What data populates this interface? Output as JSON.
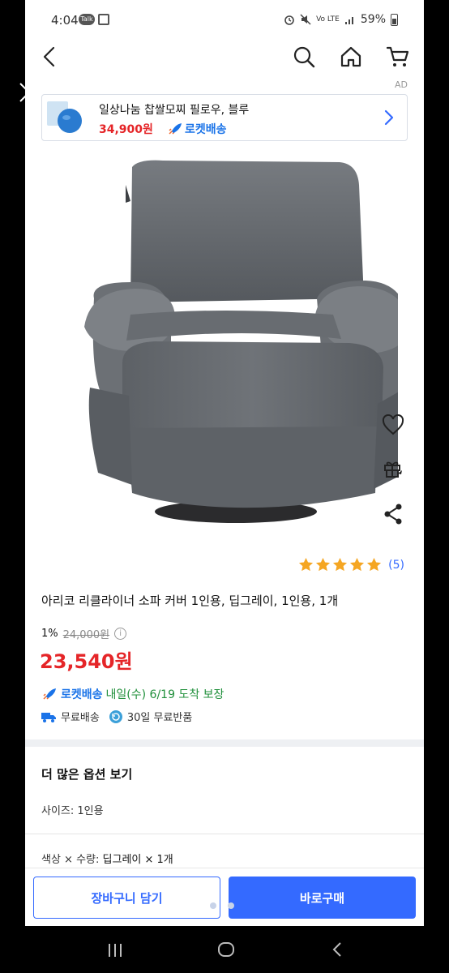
{
  "status_bar": {
    "time": "4:04",
    "notif_badge": "Talk",
    "network": "Vo LTE",
    "battery": "59%"
  },
  "ad": {
    "label": "AD",
    "title": "일상나눔 찹쌀모찌 필로우, 블루",
    "price": "34,900원",
    "rocket": "로켓배송"
  },
  "product": {
    "rating_count": "(5)",
    "rating": 5,
    "title": "아리코 리클라이너 소파 커버 1인용, 딥그레이, 1인용, 1개",
    "discount": "1%",
    "original_price": "24,000원",
    "info": "i",
    "sale_price": "23,540원",
    "rocket_label": "로켓배송",
    "delivery_text": "내일(수) 6/19 도착 보장",
    "free_shipping": "무료배송",
    "free_return": "30일 무료반품"
  },
  "options": {
    "heading": "더 많은 옵션 보기",
    "size": "사이즈: 1인용",
    "color_qty_label": "색상 × 수량:",
    "color_qty_value": "딥그레이 × 1개"
  },
  "actions": {
    "cart_button": "장바구니 담기",
    "buy_button": "바로구매"
  },
  "colors": {
    "accent": "#346aff",
    "price_red": "#e52528",
    "delivery_green": "#1f8f3a"
  }
}
